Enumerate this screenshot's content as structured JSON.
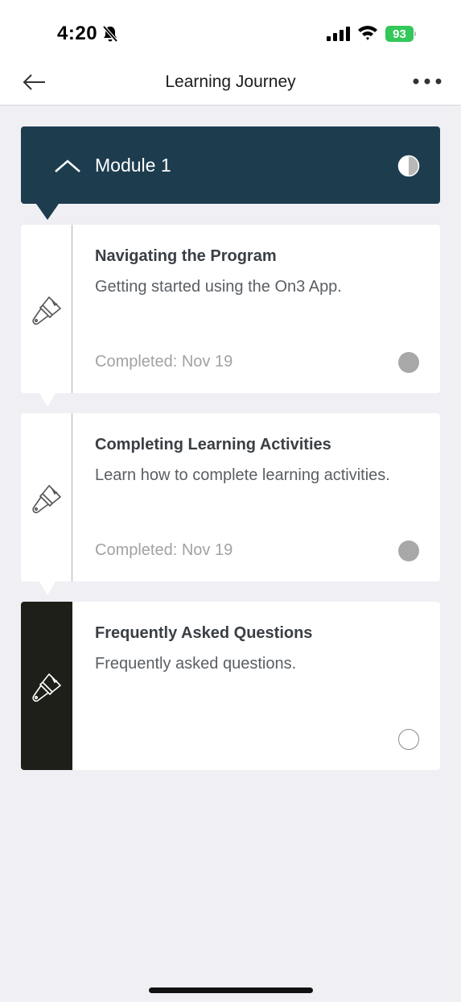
{
  "status_bar": {
    "time": "4:20",
    "battery": "93"
  },
  "header": {
    "title": "Learning Journey"
  },
  "module": {
    "title": "Module 1"
  },
  "activities": [
    {
      "title": "Navigating the Program",
      "description": "Getting started using the On3 App.",
      "status": "Completed: Nov 19",
      "completed": true
    },
    {
      "title": "Completing Learning Activities",
      "description": "Learn how to complete learning activities.",
      "status": "Completed: Nov 19",
      "completed": true
    },
    {
      "title": "Frequently Asked Questions",
      "description": "Frequently asked questions.",
      "status": "",
      "completed": false
    }
  ],
  "colors": {
    "module_bg": "#1d3d4f",
    "active_rail": "#1f1f19",
    "battery": "#34c759",
    "page_bg": "#efeff4"
  },
  "icons": {
    "back": "arrow-left-icon",
    "more": "more-horizontal-icon",
    "module_toggle": "chevron-up-icon",
    "module_progress": "half-circle-icon",
    "activity": "paintbrush-icon"
  }
}
